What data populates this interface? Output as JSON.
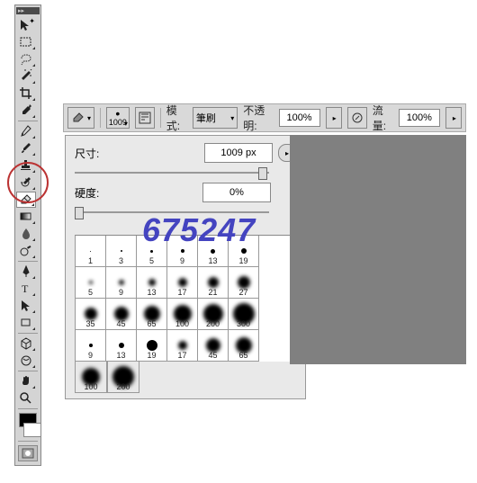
{
  "toolbar": {
    "header": "▸▸",
    "tools": [
      "move",
      "marquee",
      "lasso",
      "wand",
      "crop",
      "eyedropper",
      "heal",
      "brush",
      "stamp",
      "history",
      "eraser",
      "gradient",
      "blur",
      "dodge",
      "pen",
      "type",
      "path",
      "rect",
      "hand",
      "zoom",
      "rotate",
      "3d-orbit",
      "3d-pan",
      "3d-slide"
    ]
  },
  "options": {
    "brush_size_display": "1009",
    "mode_label": "模式:",
    "mode_value": "筆刷",
    "opacity_label": "不透明:",
    "opacity_value": "100%",
    "flow_label": "流量:",
    "flow_value": "100%"
  },
  "panel": {
    "size_label": "尺寸:",
    "size_value": "1009 px",
    "hardness_label": "硬度:",
    "hardness_value": "0%"
  },
  "presets": [
    {
      "v": "1",
      "d": 1,
      "s": 0
    },
    {
      "v": "3",
      "d": 2,
      "s": 0
    },
    {
      "v": "5",
      "d": 3,
      "s": 0
    },
    {
      "v": "9",
      "d": 4,
      "s": 0
    },
    {
      "v": "13",
      "d": 5,
      "s": 0
    },
    {
      "v": "19",
      "d": 6,
      "s": 0
    },
    {
      "v": "5",
      "d": 4,
      "s": 1
    },
    {
      "v": "9",
      "d": 6,
      "s": 1
    },
    {
      "v": "13",
      "d": 8,
      "s": 1
    },
    {
      "v": "17",
      "d": 10,
      "s": 1
    },
    {
      "v": "21",
      "d": 12,
      "s": 1
    },
    {
      "v": "27",
      "d": 14,
      "s": 1
    },
    {
      "v": "35",
      "d": 14,
      "s": 1
    },
    {
      "v": "45",
      "d": 16,
      "s": 1
    },
    {
      "v": "65",
      "d": 18,
      "s": 1
    },
    {
      "v": "100",
      "d": 20,
      "s": 1
    },
    {
      "v": "200",
      "d": 22,
      "s": 1
    },
    {
      "v": "300",
      "d": 24,
      "s": 1
    },
    {
      "v": "9",
      "d": 4,
      "s": 0
    },
    {
      "v": "13",
      "d": 6,
      "s": 0
    },
    {
      "v": "19",
      "d": 12,
      "s": 0
    },
    {
      "v": "17",
      "d": 10,
      "s": 1
    },
    {
      "v": "45",
      "d": 16,
      "s": 1
    },
    {
      "v": "65",
      "d": 18,
      "s": 1
    },
    {
      "v": "100",
      "d": 20,
      "s": 1
    },
    {
      "v": "200",
      "d": 24,
      "s": 1
    }
  ],
  "watermark": "675247"
}
